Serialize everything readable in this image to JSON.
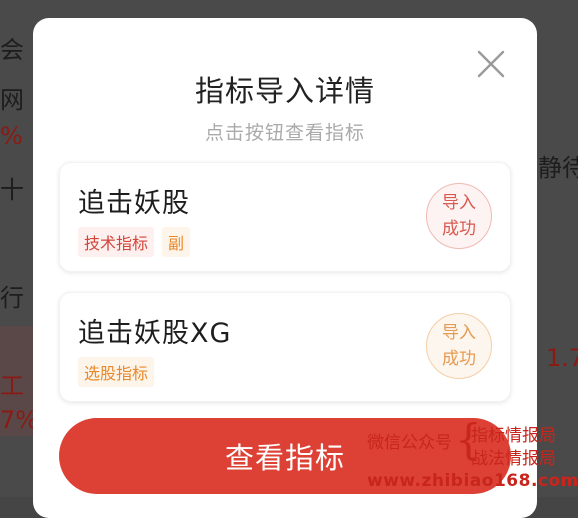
{
  "background": {
    "left_fragments": [
      "会",
      "网",
      "%",
      "十",
      "行",
      "工",
      "7%"
    ],
    "right_fragments": [
      "静待",
      "1.7"
    ]
  },
  "modal": {
    "title": "指标导入详情",
    "subtitle": "点击按钮查看指标",
    "close_icon": "close-icon",
    "cards": [
      {
        "name": "追击妖股",
        "tags": [
          {
            "label": "技术指标",
            "style": "red"
          },
          {
            "label": "副",
            "style": "orange"
          }
        ],
        "status_line1": "导入",
        "status_line2": "成功",
        "status_color": "#d85a50"
      },
      {
        "name": "追击妖股XG",
        "tags": [
          {
            "label": "选股指标",
            "style": "orange"
          }
        ],
        "status_line1": "导入",
        "status_line2": "成功",
        "status_color": "#e59b52"
      }
    ],
    "cta_label": "查看指标"
  },
  "watermark": {
    "label": "微信公众号",
    "line1": "指标情报局",
    "line2": "战法情报局",
    "url": "www.zhibiao168.com"
  },
  "colors": {
    "accent": "#dd4034",
    "tag_red": "#d2463a",
    "tag_orange": "#e8892c",
    "watermark": "#c8261c"
  }
}
